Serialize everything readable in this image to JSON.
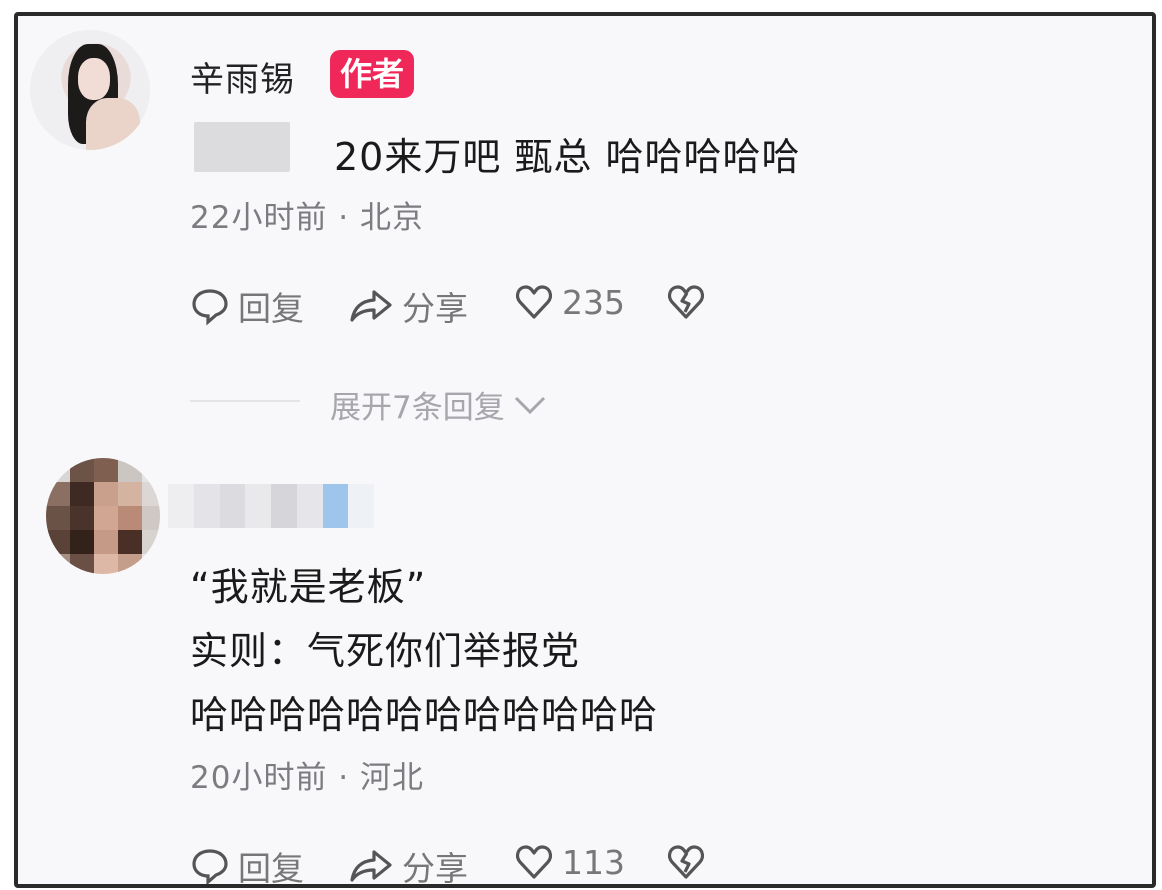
{
  "comment1": {
    "username": "辛雨锡",
    "badge": "作者",
    "text": "20来万吧 甄总 哈哈哈哈哈",
    "meta": "22小时前 · 北京",
    "reply_label": "回复",
    "share_label": "分享",
    "like_count": "235"
  },
  "expand_label": "展开7条回复",
  "comment2": {
    "line1": "“我就是老板”",
    "line2": "实则：气死你们举报党",
    "line3": "哈哈哈哈哈哈哈哈哈哈哈哈",
    "meta": "20小时前 · 河北",
    "reply_label": "回复",
    "share_label": "分享",
    "like_count": "113"
  },
  "icons": {
    "reply": "comment-bubble-icon",
    "share": "share-arrow-icon",
    "like": "heart-icon",
    "dislike": "broken-heart-icon",
    "expand": "chevron-down-icon"
  },
  "colors": {
    "badge": "#f0285a",
    "text": "#1a1a1a",
    "meta": "#7b7b80",
    "background": "#f8f8fb"
  }
}
